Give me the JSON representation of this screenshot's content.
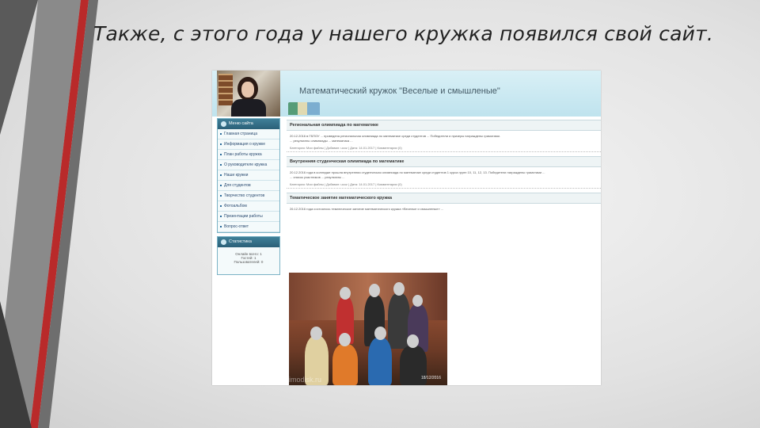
{
  "slide": {
    "title": "Также, с этого года у нашего кружка появился свой сайт."
  },
  "site": {
    "title": "Математический кружок \"Веселые и смышленые\"",
    "menu_header": "Меню сайта",
    "menu_items": [
      "Главная страница",
      "Информация о кружке",
      "План работы кружка",
      "О руководителе кружка",
      "Наши кружки",
      "Для студентов",
      "Творчество студентов",
      "Фотоальбом",
      "Презентации работы",
      "Вопрос-ответ"
    ],
    "stats_header": "Статистика",
    "stats_lines": [
      "Онлайн всего: 1",
      "Гостей: 1",
      "Пользователей: 0"
    ],
    "posts": [
      {
        "title": "Региональная олимпиада по математике",
        "text": "20.12.2016 в ГБПОУ ... проведена региональная олимпиада по математике среди студентов ... Победители и призеры награждены грамотами.",
        "text2": "... результаты олимпиады ... математика ...",
        "meta": "Категория: Мои файлы | Добавил: ucoz | Дата: 14.01.2017 | Комментарии (0)"
      },
      {
        "title": "Внутренняя студенческая олимпиада по математике",
        "text": "20.12.2016 года в колледже прошла внутренняя студенческая олимпиада по математике среди студентов 1 курса групп 10, 11, 12, 13. Победители награждены грамотами ...",
        "text2": "... список участников ... результаты ...",
        "meta": "Категория: Мои файлы | Добавил: ucoz | Дата: 14.01.2017 | Комментарии (0)"
      },
      {
        "title": "Тематическое занятие математического кружка",
        "text": "26.12.2016 года состоялось тематическое занятие математического кружка «Веселые и смышленые» ...",
        "meta": ""
      }
    ],
    "photo": {
      "date": "18/12/2016",
      "watermark": "imodisk.ru"
    }
  },
  "colors": {
    "header_bg": "#bfe3ee",
    "sidebar_head": "#2b6078",
    "link": "#2a4a70"
  }
}
